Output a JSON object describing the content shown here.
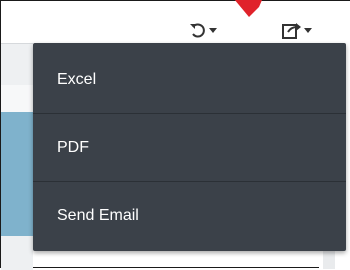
{
  "toolbar": {
    "undo_icon": "undo-icon",
    "export_icon": "export-share-icon"
  },
  "menu": {
    "items": [
      {
        "label": "Excel"
      },
      {
        "label": "PDF"
      },
      {
        "label": "Send Email"
      }
    ]
  },
  "colors": {
    "menu_background": "#3b4149",
    "menu_text": "#ffffff",
    "annotation_arrow": "#e0222a",
    "selected_row": "#7fb2cc"
  }
}
